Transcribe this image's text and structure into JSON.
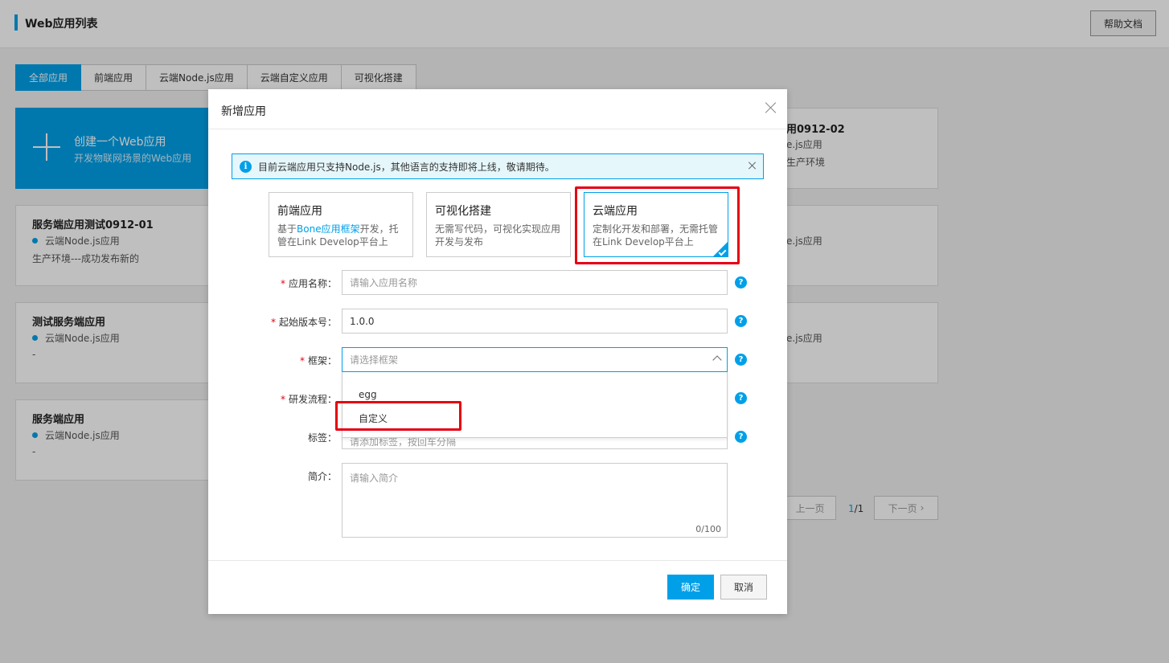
{
  "header": {
    "title": "Web应用列表",
    "help_label": "帮助文档"
  },
  "tabs": [
    "全部应用",
    "前端应用",
    "云端Node.js应用",
    "云端自定义应用",
    "可视化搭建"
  ],
  "create_card": {
    "title": "创建一个Web应用",
    "subtitle": "开发物联网场景的Web应用"
  },
  "app_cards": [
    {
      "name": "服务端应用测试0912-01",
      "type": "云端Node.js应用",
      "desc": "生产环境---成功发布新的"
    },
    {
      "name": "测试服务端应用",
      "type": "云端Node.js应用",
      "desc": "-"
    },
    {
      "name": "服务端应用",
      "type": "云端Node.js应用",
      "desc": "-"
    }
  ],
  "right_cards": [
    {
      "name": "用0912-02",
      "type": "e.js应用",
      "env": "生产环境"
    },
    {
      "type": "e.js应用"
    },
    {
      "type": "e.js应用"
    }
  ],
  "pager": {
    "prev": "上一页",
    "current": "1",
    "total": "/1",
    "next": "下一页"
  },
  "dialog": {
    "title": "新增应用",
    "notice": "目前云端应用只支持Node.js，其他语言的支持即将上线，敬请期待。",
    "types": [
      {
        "title": "前端应用",
        "desc_pre": "基于",
        "desc_link": "Bone应用框架",
        "desc_post": "开发，托管在Link Develop平台上"
      },
      {
        "title": "可视化搭建",
        "desc": "无需写代码，可视化实现应用开发与发布"
      },
      {
        "title": "云端应用",
        "desc": "定制化开发和部署，无需托管在Link Develop平台上"
      }
    ],
    "fields": {
      "name_label": "应用名称：",
      "name_placeholder": "请输入应用名称",
      "version_label": "起始版本号：",
      "version_value": "1.0.0",
      "framework_label": "框架：",
      "framework_placeholder": "请选择框架",
      "flow_label": "研发流程：",
      "tags_label": "标签：",
      "tags_placeholder": "请添加标签，按回车分隔",
      "intro_label": "简介：",
      "intro_placeholder": "请输入简介",
      "intro_count": "0/100"
    },
    "framework_options": [
      "egg",
      "自定义"
    ],
    "ok_label": "确定",
    "cancel_label": "取消"
  }
}
